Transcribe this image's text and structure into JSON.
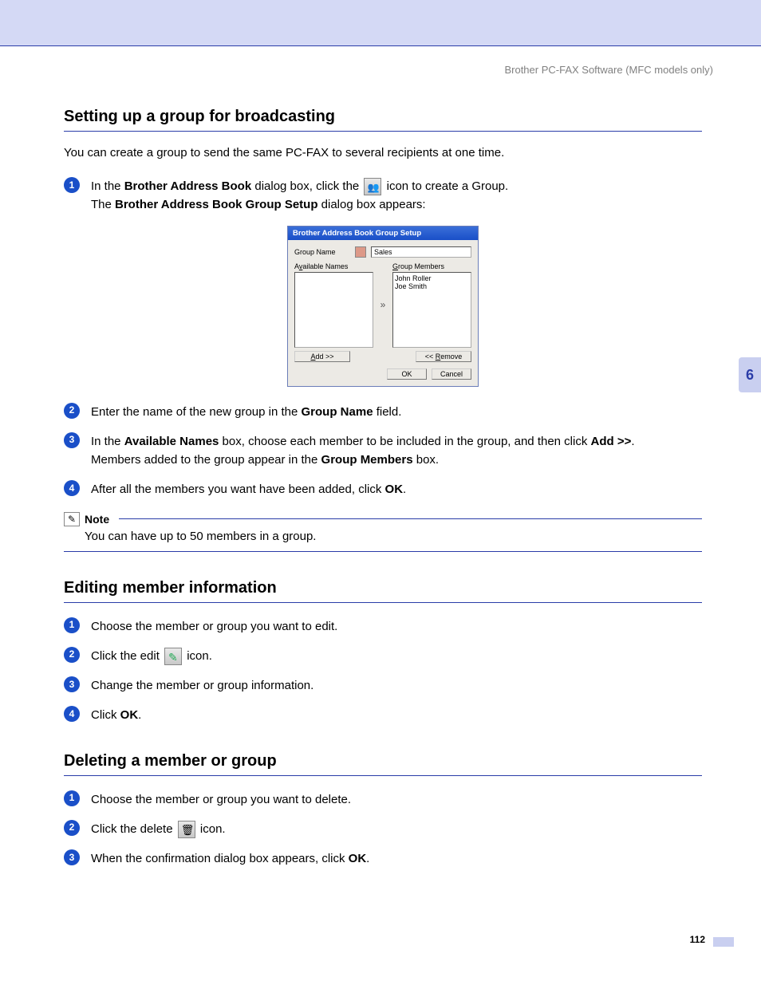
{
  "header": "Brother PC-FAX Software (MFC models only)",
  "chapter_tab": "6",
  "page_number": "112",
  "sections": {
    "s1": {
      "title": "Setting up a group for broadcasting",
      "intro": "You can create a group to send the same PC-FAX to several recipients at one time.",
      "steps": {
        "n1": "1",
        "t1a": "In the ",
        "t1b": "Brother Address Book",
        "t1c": " dialog box, click the ",
        "t1d": " icon to create a Group.",
        "t1e": "The ",
        "t1f": "Brother Address Book Group Setup",
        "t1g": " dialog box appears:",
        "n2": "2",
        "t2a": "Enter the name of the new group in the ",
        "t2b": "Group Name",
        "t2c": " field.",
        "n3": "3",
        "t3a": "In the ",
        "t3b": "Available Names",
        "t3c": " box, choose each member to be included in the group, and then click ",
        "t3d": "Add >>",
        "t3e": ".",
        "t3f": "Members added to the group appear in the ",
        "t3g": "Group Members",
        "t3h": " box.",
        "n4": "4",
        "t4a": "After all the members you want have been added, click ",
        "t4b": "OK",
        "t4c": "."
      },
      "note": {
        "title": "Note",
        "body": "You can have up to 50 members in a group."
      }
    },
    "s2": {
      "title": "Editing member information",
      "steps": {
        "n1": "1",
        "t1": "Choose the member or group you want to edit.",
        "n2": "2",
        "t2a": "Click the edit ",
        "t2b": " icon.",
        "n3": "3",
        "t3": "Change the member or group information.",
        "n4": "4",
        "t4a": "Click ",
        "t4b": "OK",
        "t4c": "."
      }
    },
    "s3": {
      "title": "Deleting a member or group",
      "steps": {
        "n1": "1",
        "t1": "Choose the member or group you want to delete.",
        "n2": "2",
        "t2a": "Click the delete ",
        "t2b": " icon.",
        "n3": "3",
        "t3a": "When the confirmation dialog box appears, click ",
        "t3b": "OK",
        "t3c": "."
      }
    }
  },
  "dialog": {
    "title": "Brother Address Book Group Setup",
    "group_name_label": "Group Name",
    "group_name_value": "Sales",
    "available_label": "Available Names",
    "members_label": "Group Members",
    "member1": "John Roller",
    "member2": "Joe Smith",
    "add_btn": "Add >>",
    "remove_btn": "<< Remove",
    "ok_btn": "OK",
    "cancel_btn": "Cancel",
    "chevron": "»"
  }
}
